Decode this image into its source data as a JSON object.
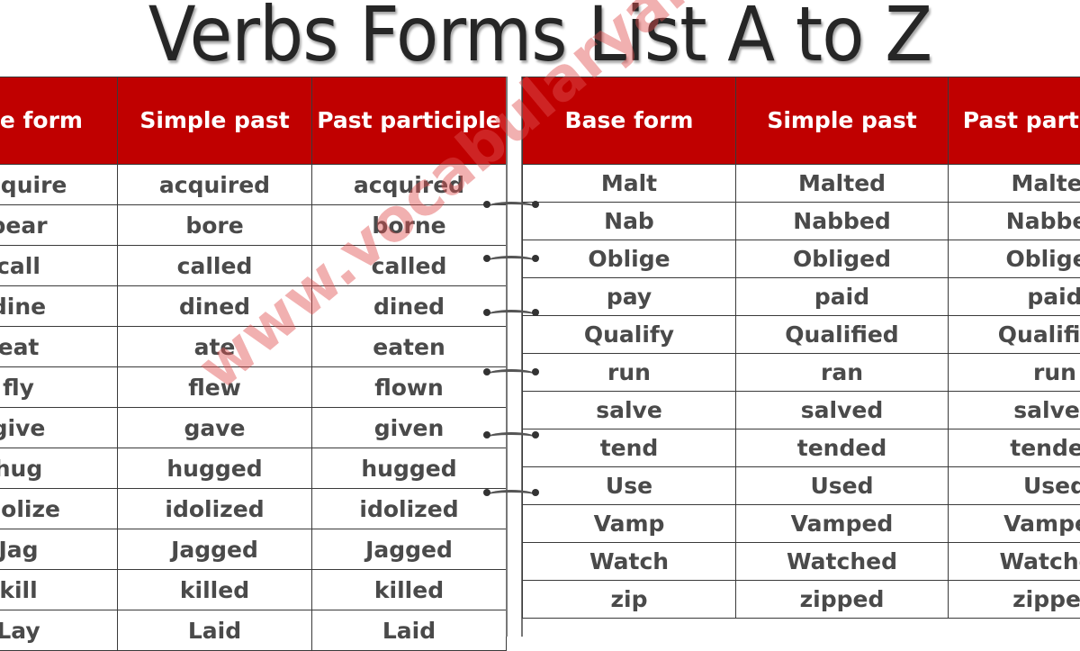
{
  "title": "Verbs Forms List A to Z",
  "watermark": "www.vocabularyan.com",
  "colors": {
    "header_bg": "#c00000",
    "header_text": "#ffffff",
    "cell_text": "#4a4a4a",
    "watermark": "#e05050"
  },
  "left_table": {
    "headers": [
      "Base form",
      "Simple past",
      "Past participle"
    ],
    "rows": [
      [
        "Acquire",
        "acquired",
        "acquired"
      ],
      [
        "bear",
        "bore",
        "borne"
      ],
      [
        "call",
        "called",
        "called"
      ],
      [
        "dine",
        "dined",
        "dined"
      ],
      [
        "eat",
        "ate",
        "eaten"
      ],
      [
        "fly",
        "flew",
        "flown"
      ],
      [
        "give",
        "gave",
        "given"
      ],
      [
        "hug",
        "hugged",
        "hugged"
      ],
      [
        "Idolize",
        "idolized",
        "idolized"
      ],
      [
        "Jag",
        "Jagged",
        "Jagged"
      ],
      [
        "kill",
        "killed",
        "killed"
      ],
      [
        "Lay",
        "Laid",
        "Laid"
      ]
    ]
  },
  "right_table": {
    "headers": [
      "Base form",
      "Simple past",
      "Past participle"
    ],
    "rows": [
      [
        "Malt",
        "Malted",
        "Malted"
      ],
      [
        "Nab",
        "Nabbed",
        "Nabbed"
      ],
      [
        "Oblige",
        "Obliged",
        "Obliged"
      ],
      [
        "pay",
        "paid",
        "paid"
      ],
      [
        "Qualify",
        "Qualified",
        "Qualified"
      ],
      [
        "run",
        "ran",
        "run"
      ],
      [
        "salve",
        "salved",
        "salved"
      ],
      [
        "tend",
        "tended",
        "tended"
      ],
      [
        "Use",
        "Used",
        "Used"
      ],
      [
        "Vamp",
        "Vamped",
        "Vamped"
      ],
      [
        "Watch",
        "Watched",
        "Watched"
      ],
      [
        "zip",
        "zipped",
        "zipped"
      ]
    ]
  }
}
